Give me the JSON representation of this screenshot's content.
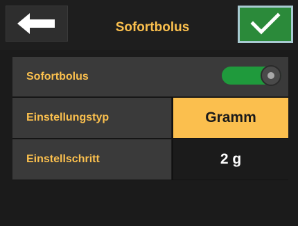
{
  "header": {
    "title": "Sofortbolus",
    "back_icon": "arrow-left-icon",
    "confirm_icon": "checkmark-icon"
  },
  "rows": [
    {
      "label": "Sofortbolus",
      "control": "toggle",
      "toggle_on": true
    },
    {
      "label": "Einstellungstyp",
      "value": "Gramm"
    },
    {
      "label": "Einstellschritt",
      "value": "2 g"
    }
  ],
  "colors": {
    "accent": "#fbc04e",
    "confirm": "#2b8a3a",
    "toggle_on": "#1f9a3c",
    "background": "#1b1b1b"
  }
}
